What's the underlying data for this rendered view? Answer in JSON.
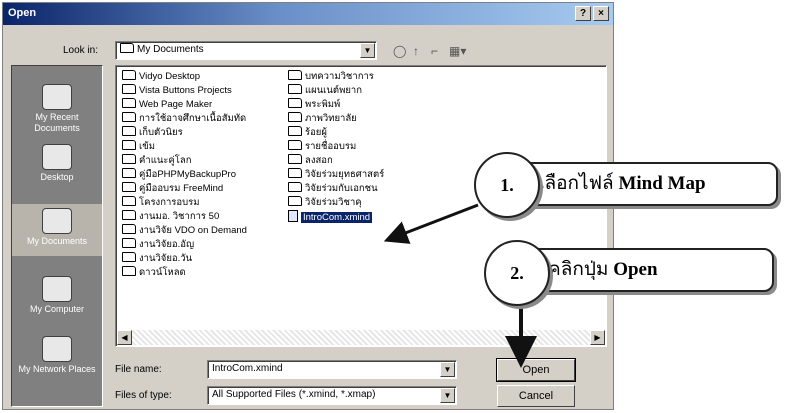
{
  "dialog": {
    "title": "Open",
    "help_button": "?",
    "close_button": "×",
    "look_in_label": "Look in:",
    "look_in_value": "My Documents"
  },
  "places": [
    {
      "label": "My Recent Documents",
      "icon": "recent-documents-icon"
    },
    {
      "label": "Desktop",
      "icon": "desktop-icon"
    },
    {
      "label": "My Documents",
      "icon": "my-documents-icon"
    },
    {
      "label": "My Computer",
      "icon": "my-computer-icon"
    },
    {
      "label": "My Network Places",
      "icon": "network-places-icon"
    }
  ],
  "files_col1": [
    "Vidyo Desktop",
    "Vista Buttons Projects",
    "Web Page Maker",
    "การใช้อาจศึกษาเนื้อสัมทัด",
    "เก็บตัวนิยร",
    "เข้ม",
    "คำแนะคู่โลก",
    "คู่มือPHPMyBackupPro",
    "คู่มืออบรม FreeMind",
    "โครงการอบรม",
    "งานมอ. วิชาการ 50",
    "งานวิจัย VDO on Demand",
    "งานวิจัยอ.อัญ",
    "งานวิจัยอ.วัน",
    "ดาวน์โหลด"
  ],
  "files_col2": [
    "บทความวิชาการ",
    "แผนเนต์พยาก",
    "พระพิมพ์",
    "ภาพวิทยาลัย",
    "ร้อยผู้",
    "รายชื่ออบรม",
    "ลงสอก",
    "วิจัยร่วมยุทธศาสตร์",
    "วิจัยร่วมกับเอกชน",
    "วิจัยร่วมวิชาคุ"
  ],
  "selected_file": "IntroCom.xmind",
  "file_name_label": "File name:",
  "file_name_value": "IntroCom.xmind",
  "file_type_label": "Files of type:",
  "file_type_value": "All Supported Files (*.xmind, *.xmap)",
  "open_button": "Open",
  "cancel_button": "Cancel",
  "callouts": [
    {
      "number": "1.",
      "text_thai": "เลือกไฟล์ ",
      "text_bold": "Mind Map"
    },
    {
      "number": "2.",
      "text_thai": "คลิกปุ่ม ",
      "text_bold": "Open"
    }
  ],
  "colors": {
    "title_gradient_start": "#0a246a",
    "dialog_face": "#d4d0c8",
    "places_bar": "#808080",
    "selection": "#0a246a"
  }
}
